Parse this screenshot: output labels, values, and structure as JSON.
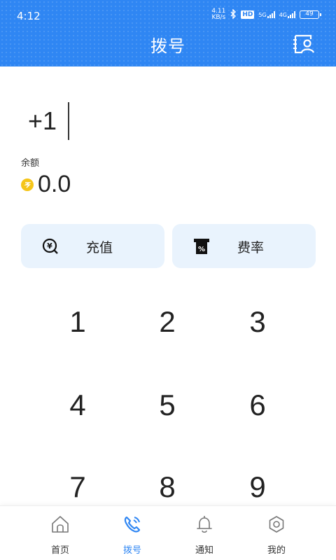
{
  "status_bar": {
    "time": "4:12",
    "network_speed": "4.11\nKB/s",
    "hd_badge": "HD",
    "signal_5g": "5G",
    "signal_4g": "4G",
    "battery": "49"
  },
  "header": {
    "title": "拨号",
    "contacts_icon": "contacts-icon",
    "accent_color": "#2f86f3"
  },
  "dialer": {
    "number_prefix": "+1"
  },
  "balance": {
    "label": "余额",
    "value": "0.0",
    "coin_icon": "coin-icon"
  },
  "actions": {
    "recharge_label": "充值",
    "rates_label": "费率"
  },
  "keypad": {
    "keys": [
      "1",
      "2",
      "3",
      "4",
      "5",
      "6",
      "7",
      "8",
      "9"
    ]
  },
  "nav": {
    "items": [
      {
        "label": "首页",
        "icon": "home-icon"
      },
      {
        "label": "拨号",
        "icon": "phone-icon",
        "active": true
      },
      {
        "label": "通知",
        "icon": "bell-icon"
      },
      {
        "label": "我的",
        "icon": "gear-icon"
      }
    ]
  }
}
